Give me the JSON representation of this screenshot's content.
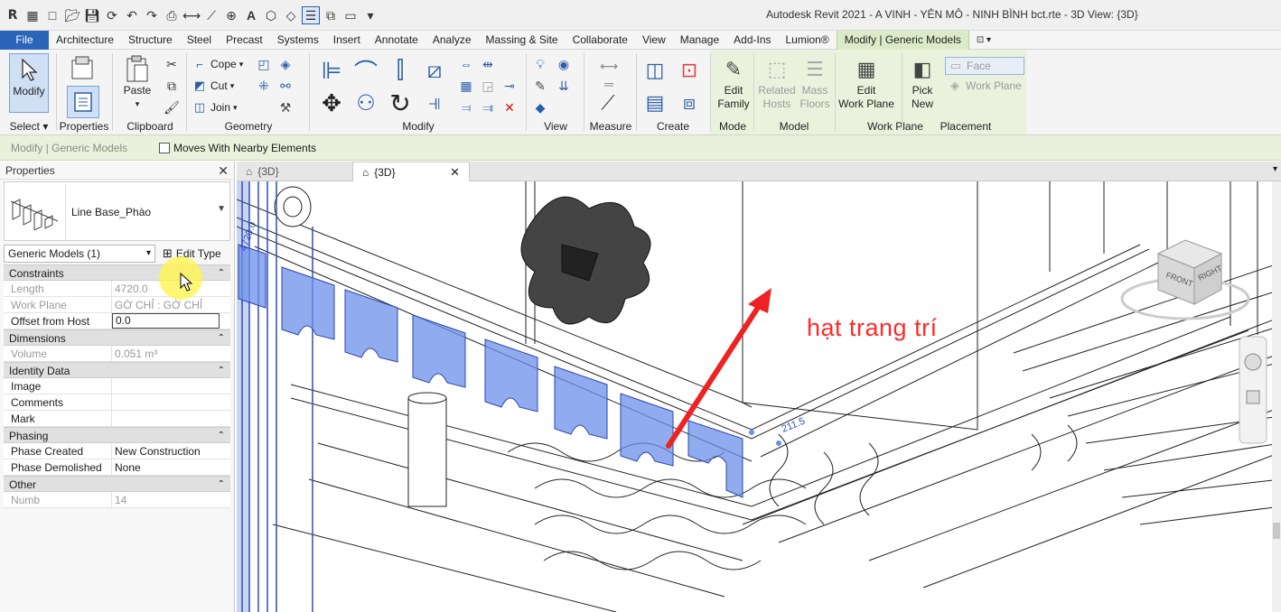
{
  "app": {
    "title": "Autodesk Revit 2021 - A VINH - YÊN MÔ - NINH BÌNH bct.rte - 3D View: {3D}",
    "logo": "R"
  },
  "menu": {
    "items": [
      "File",
      "Architecture",
      "Structure",
      "Steel",
      "Precast",
      "Systems",
      "Insert",
      "Annotate",
      "Analyze",
      "Massing & Site",
      "Collaborate",
      "View",
      "Manage",
      "Add-Ins",
      "Lumion®",
      "Modify | Generic Models"
    ],
    "active": "Modify | Generic Models"
  },
  "ribbon": {
    "select": {
      "modify": "Modify",
      "label": "Select ▾"
    },
    "properties": {
      "label": "Properties"
    },
    "clipboard": {
      "paste": "Paste",
      "label": "Clipboard"
    },
    "geometry": {
      "cope": "Cope",
      "cut": "Cut",
      "join": "Join",
      "label": "Geometry"
    },
    "modify": {
      "label": "Modify"
    },
    "view": {
      "label": "View"
    },
    "measure": {
      "label": "Measure"
    },
    "create": {
      "label": "Create"
    },
    "mode": {
      "edit_family_1": "Edit",
      "edit_family_2": "Family",
      "label": "Mode"
    },
    "model": {
      "related_hosts_1": "Related",
      "related_hosts_2": "Hosts",
      "mass_floors_1": "Mass",
      "mass_floors_2": "Floors",
      "label": "Model"
    },
    "work_plane": {
      "edit_1": "Edit",
      "edit_2": "Work Plane",
      "label": "Work Plane"
    },
    "placement": {
      "pick_1": "Pick",
      "pick_2": "New",
      "face": "Face",
      "work_plane": "Work Plane",
      "label": "Placement"
    }
  },
  "options_bar": {
    "context": "Modify | Generic Models",
    "moves_with_nearby": "Moves With Nearby Elements"
  },
  "properties": {
    "header": "Properties",
    "type_name": "Line Base_Phào",
    "instance_filter": "Generic Models (1)",
    "edit_type": "Edit Type",
    "groups": [
      {
        "name": "Constraints",
        "rows": [
          {
            "k": "Length",
            "v": "4720.0",
            "ro": true
          },
          {
            "k": "Work Plane",
            "v": "GỜ CHỈ : GỜ CHỈ",
            "ro": true
          },
          {
            "k": "Offset from Host",
            "v": "0.0",
            "ro": false
          }
        ]
      },
      {
        "name": "Dimensions",
        "rows": [
          {
            "k": "Volume",
            "v": "0.051 m³",
            "ro": true
          }
        ]
      },
      {
        "name": "Identity Data",
        "rows": [
          {
            "k": "Image",
            "v": "",
            "ro": false
          },
          {
            "k": "Comments",
            "v": "",
            "ro": false
          },
          {
            "k": "Mark",
            "v": "",
            "ro": false
          }
        ]
      },
      {
        "name": "Phasing",
        "rows": [
          {
            "k": "Phase Created",
            "v": "New Construction",
            "ro": false
          },
          {
            "k": "Phase Demolished",
            "v": "None",
            "ro": false
          }
        ]
      },
      {
        "name": "Other",
        "rows": [
          {
            "k": "Numb",
            "v": "14",
            "ro": true
          }
        ]
      }
    ]
  },
  "tabs": [
    {
      "label": "{3D}",
      "active": false
    },
    {
      "label": "{3D}",
      "active": true
    }
  ],
  "viewport": {
    "annotation": "hạt trang trí",
    "dim_left": "4720.0",
    "dim_right": "211.5",
    "viewcube_front": "FRONT",
    "viewcube_right": "RIGHT"
  },
  "colors": {
    "accent": "#2b65b9",
    "context_tab": "#dcebc7",
    "selection": "#3d6fd6",
    "annotation": "#ff2a2a"
  }
}
